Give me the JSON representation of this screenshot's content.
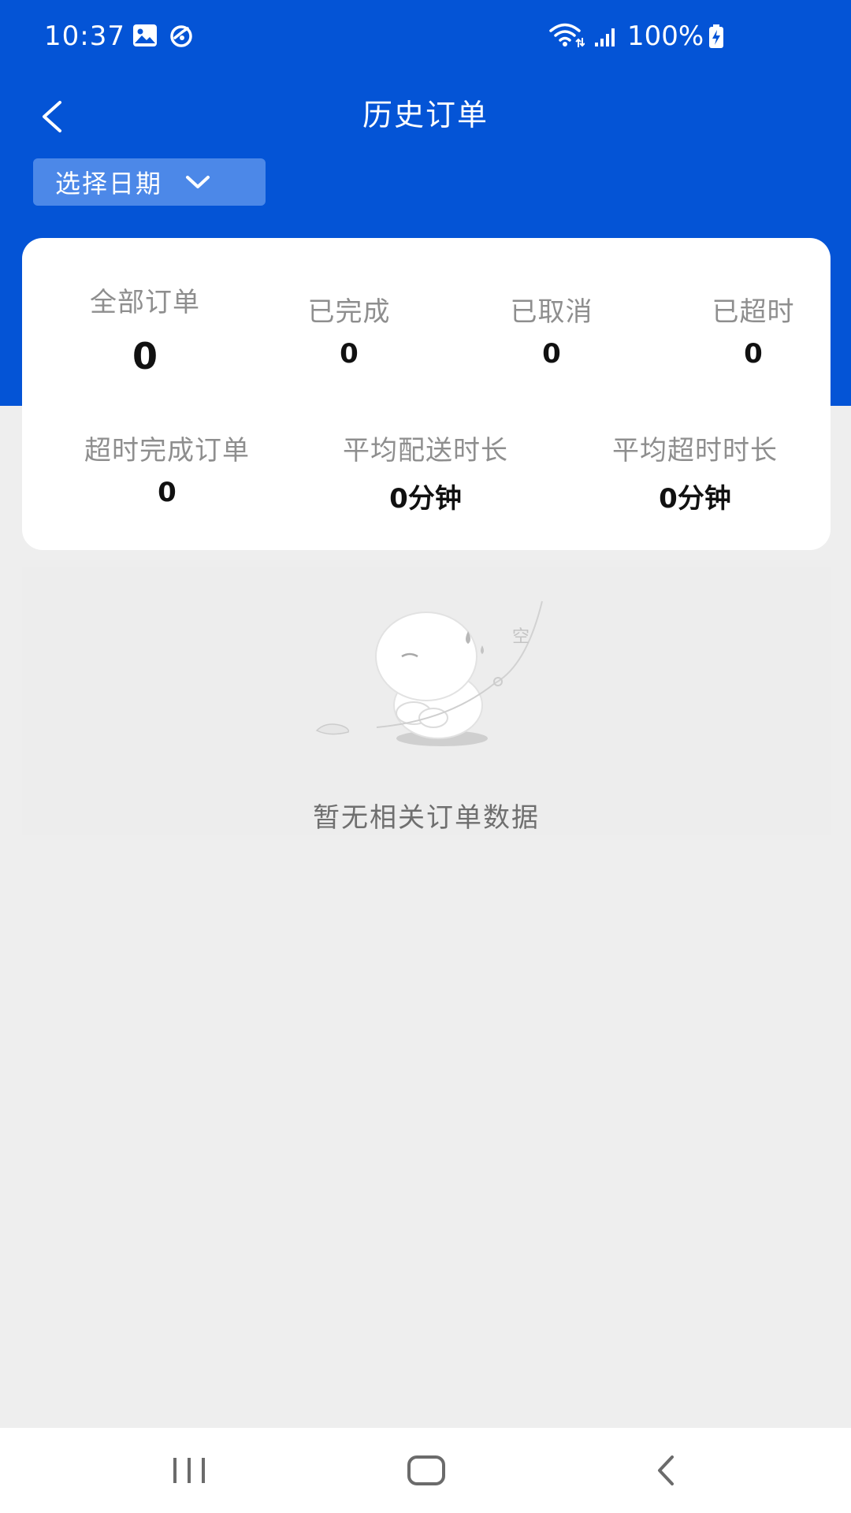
{
  "status_bar": {
    "time": "10:37",
    "battery": "100%",
    "icons": [
      "image-icon",
      "app-notification-icon",
      "wifi-icon",
      "signal-icon",
      "battery-charging-icon"
    ]
  },
  "header": {
    "title": "历史订单",
    "back_icon": "chevron-left-icon"
  },
  "date_filter": {
    "label": "选择日期",
    "icon": "chevron-down-icon"
  },
  "stats": {
    "row1": [
      {
        "label": "全部订单",
        "value": "0"
      },
      {
        "label": "已完成",
        "value": "0"
      },
      {
        "label": "已取消",
        "value": "0"
      },
      {
        "label": "已超时",
        "value": "0"
      }
    ],
    "row2": [
      {
        "label": "超时完成订单",
        "value": "0"
      },
      {
        "label": "平均配送时长",
        "value": "0分钟"
      },
      {
        "label": "平均超时时长",
        "value": "0分钟"
      }
    ]
  },
  "empty_state": {
    "illustration_text": "空",
    "message": "暂无相关订单数据"
  },
  "nav_bar": {
    "icons": [
      "recent-apps-icon",
      "home-icon",
      "back-icon"
    ]
  },
  "colors": {
    "primary": "#0454d6",
    "date_button": "#4c88e8",
    "background": "#eeeeee",
    "card": "#ffffff"
  }
}
